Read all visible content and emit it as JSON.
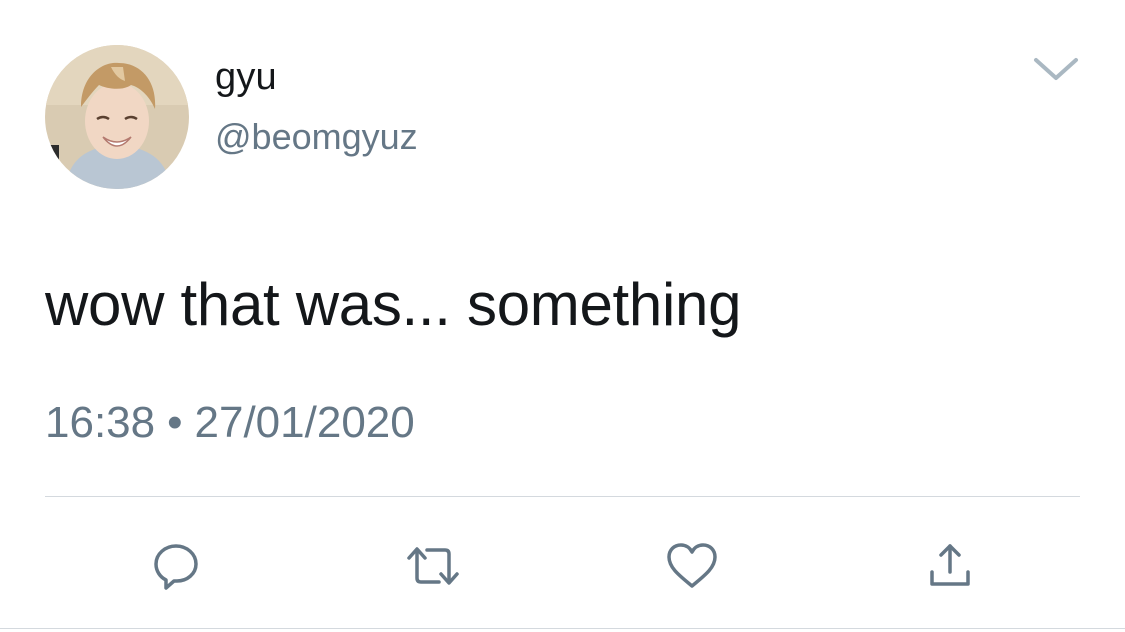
{
  "tweet": {
    "author": {
      "display_name": "gyu",
      "handle": "@beomgyuz"
    },
    "text": "wow that was... something",
    "time": "16:38",
    "separator": "•",
    "date": "27/01/2020"
  },
  "icons": {
    "menu": "chevron-down-icon",
    "actions": [
      "reply-icon",
      "retweet-icon",
      "like-icon",
      "share-icon"
    ]
  },
  "colors": {
    "text_primary": "#14171a",
    "text_secondary": "#657786",
    "icon": "#657786",
    "divider": "#d4d9de"
  }
}
